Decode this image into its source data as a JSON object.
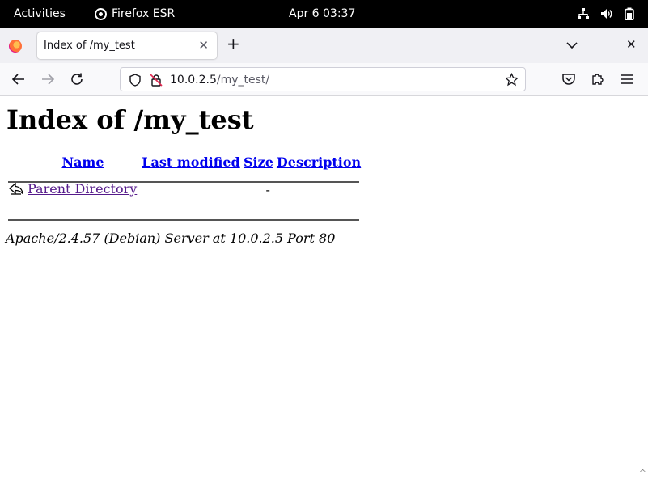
{
  "topbar": {
    "activities": "Activities",
    "app_name": "Firefox ESR",
    "clock": "Apr 6  03:37"
  },
  "browser": {
    "tab_title": "Index of /my_test",
    "url_host": "10.0.2.5",
    "url_path": "/my_test/"
  },
  "page": {
    "heading": "Index of /my_test",
    "columns": [
      "Name",
      "Last modified",
      "Size",
      "Description"
    ],
    "rows": [
      {
        "name": "Parent Directory",
        "last_modified": "",
        "size": "-",
        "description": ""
      }
    ],
    "address": "Apache/2.4.57 (Debian) Server at 10.0.2.5 Port 80"
  },
  "colors": {
    "link": "#0000ee",
    "visited_link": "#551a8b"
  }
}
